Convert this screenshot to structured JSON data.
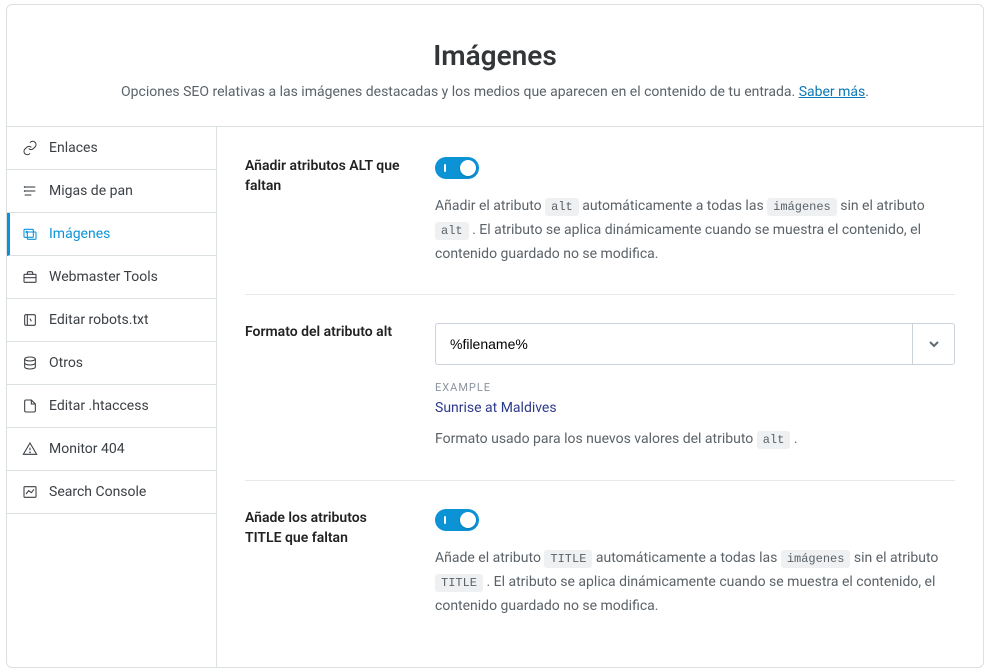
{
  "header": {
    "title": "Imágenes",
    "subtitle_prefix": "Opciones SEO relativas a las imágenes destacadas y los medios que aparecen en el contenido de tu entrada. ",
    "learn_more": "Saber más",
    "subtitle_suffix": "."
  },
  "sidebar": {
    "items": [
      {
        "id": "enlaces",
        "label": "Enlaces",
        "icon": "link-icon"
      },
      {
        "id": "migas",
        "label": "Migas de pan",
        "icon": "breadcrumb-icon"
      },
      {
        "id": "imagenes",
        "label": "Imágenes",
        "icon": "image-icon",
        "active": true
      },
      {
        "id": "webmaster",
        "label": "Webmaster Tools",
        "icon": "toolbox-icon"
      },
      {
        "id": "robots",
        "label": "Editar robots.txt",
        "icon": "robots-icon"
      },
      {
        "id": "otros",
        "label": "Otros",
        "icon": "stack-icon"
      },
      {
        "id": "htaccess",
        "label": "Editar .htaccess",
        "icon": "file-icon"
      },
      {
        "id": "monitor",
        "label": "Monitor 404",
        "icon": "warning-icon"
      },
      {
        "id": "search",
        "label": "Search Console",
        "icon": "chart-icon"
      }
    ]
  },
  "fields": {
    "alt_toggle": {
      "label": "Añadir atributos ALT que faltan",
      "on": true,
      "desc_parts": [
        "Añadir el atributo ",
        "alt",
        " automáticamente a todas las ",
        "imágenes",
        " sin el atributo ",
        "alt",
        " . El atributo se aplica dinámicamente cuando se muestra el contenido, el contenido guardado no se modifica."
      ]
    },
    "alt_format": {
      "label": "Formato del atributo alt",
      "value": "%filename%",
      "example_label": "EXAMPLE",
      "example_value": "Sunrise at Maldives",
      "desc_parts": [
        "Formato usado para los nuevos valores del atributo ",
        "alt",
        " ."
      ]
    },
    "title_toggle": {
      "label": "Añade los atributos TITLE que faltan",
      "on": true,
      "desc_parts": [
        "Añade el atributo ",
        "TITLE",
        " automáticamente a todas las ",
        "imágenes",
        " sin el atributo ",
        "TITLE",
        " . El atributo se aplica dinámicamente cuando se muestra el contenido, el contenido guardado no se modifica."
      ]
    }
  }
}
